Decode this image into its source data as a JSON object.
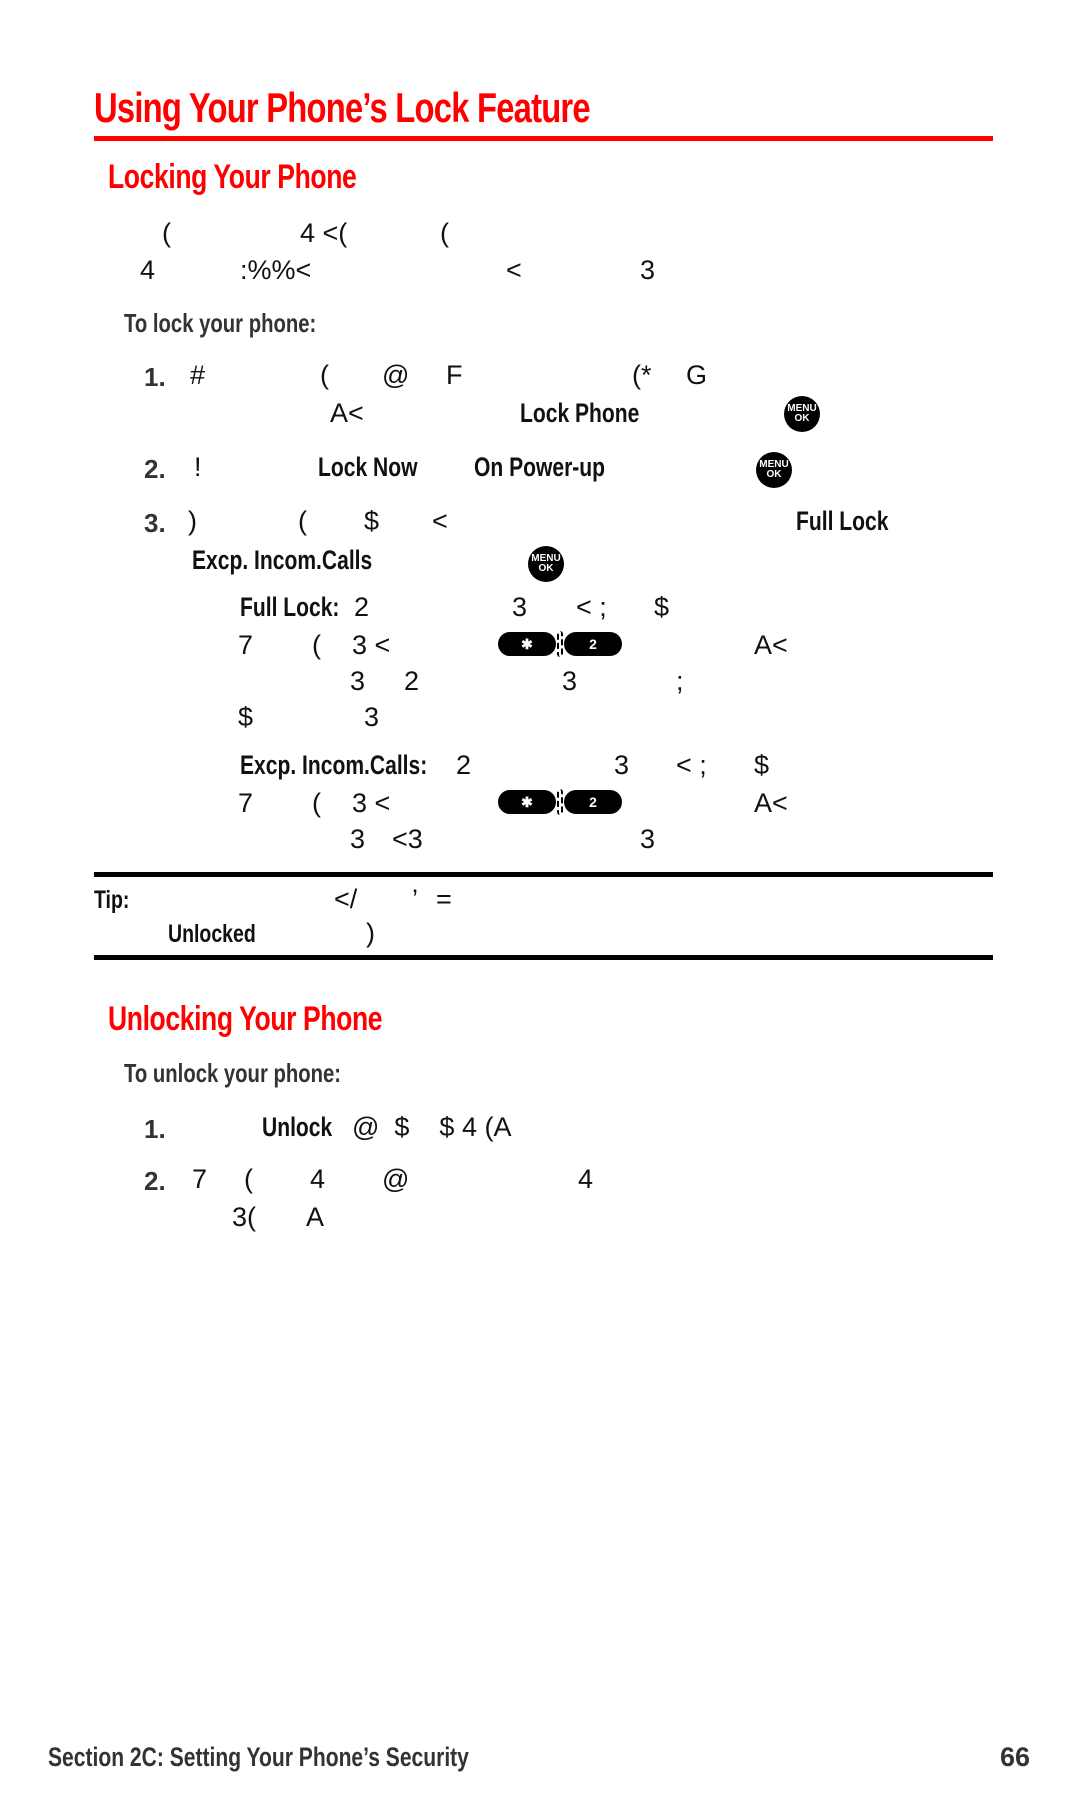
{
  "page": {
    "title": "Using Your Phone’s Lock Feature",
    "accent_color": "#ff0000"
  },
  "locking": {
    "heading": "Locking Your Phone",
    "intro_line1": [
      "(",
      "4 <(",
      "("
    ],
    "intro_line2": [
      "4",
      ":%%<",
      "<",
      "3"
    ],
    "subheading": "To lock your phone:",
    "steps": [
      {
        "number": "1.",
        "line1": [
          "#",
          "(",
          "@",
          "F",
          "(*",
          "G"
        ],
        "line2_prefix": "A<",
        "bold_term": "Lock Phone",
        "icon": "menu-ok-icon"
      },
      {
        "number": "2.",
        "glyph": "!",
        "bold_term_1": "Lock Now",
        "bold_term_2": "On Power-up",
        "icon": "menu-ok-icon"
      },
      {
        "number": "3.",
        "line1": [
          ")",
          "(",
          "$",
          "<"
        ],
        "bold_term_1": "Full Lock",
        "bold_term_2": "Excp. Incom.Calls",
        "icon": "menu-ok-icon"
      }
    ],
    "options": [
      {
        "label": "Full Lock:",
        "line1": [
          "2",
          "3",
          "< ;",
          "$"
        ],
        "line2": [
          "7",
          "(",
          "3 <",
          "A<"
        ],
        "keys": [
          "✱",
          "2"
        ],
        "line3": [
          "3",
          "2",
          "3",
          ";"
        ],
        "line4": [
          "$",
          "3"
        ]
      },
      {
        "label": "Excp. Incom.Calls:",
        "line1": [
          "2",
          "3",
          "< ;",
          "$"
        ],
        "line2": [
          "7",
          "(",
          "3 <",
          "A<"
        ],
        "keys": [
          "✱",
          "2"
        ],
        "line3": [
          "3",
          "<3",
          "3"
        ]
      }
    ]
  },
  "tip": {
    "label": "Tip:",
    "line1": [
      "</",
      "’",
      "="
    ],
    "bold_term": "Unlocked",
    "line2_after": ")"
  },
  "unlocking": {
    "heading": "Unlocking Your Phone",
    "subheading": "To unlock your phone:",
    "steps": [
      {
        "number": "1.",
        "bold_term": "Unlock",
        "after": "@  $    $ 4 (A"
      },
      {
        "number": "2.",
        "line1": [
          "7",
          "(",
          "4",
          "@",
          "4"
        ],
        "line2": [
          "3(",
          "A"
        ]
      }
    ]
  },
  "footer": {
    "section": "Section 2C: Setting Your Phone’s Security",
    "page_number": "66"
  }
}
